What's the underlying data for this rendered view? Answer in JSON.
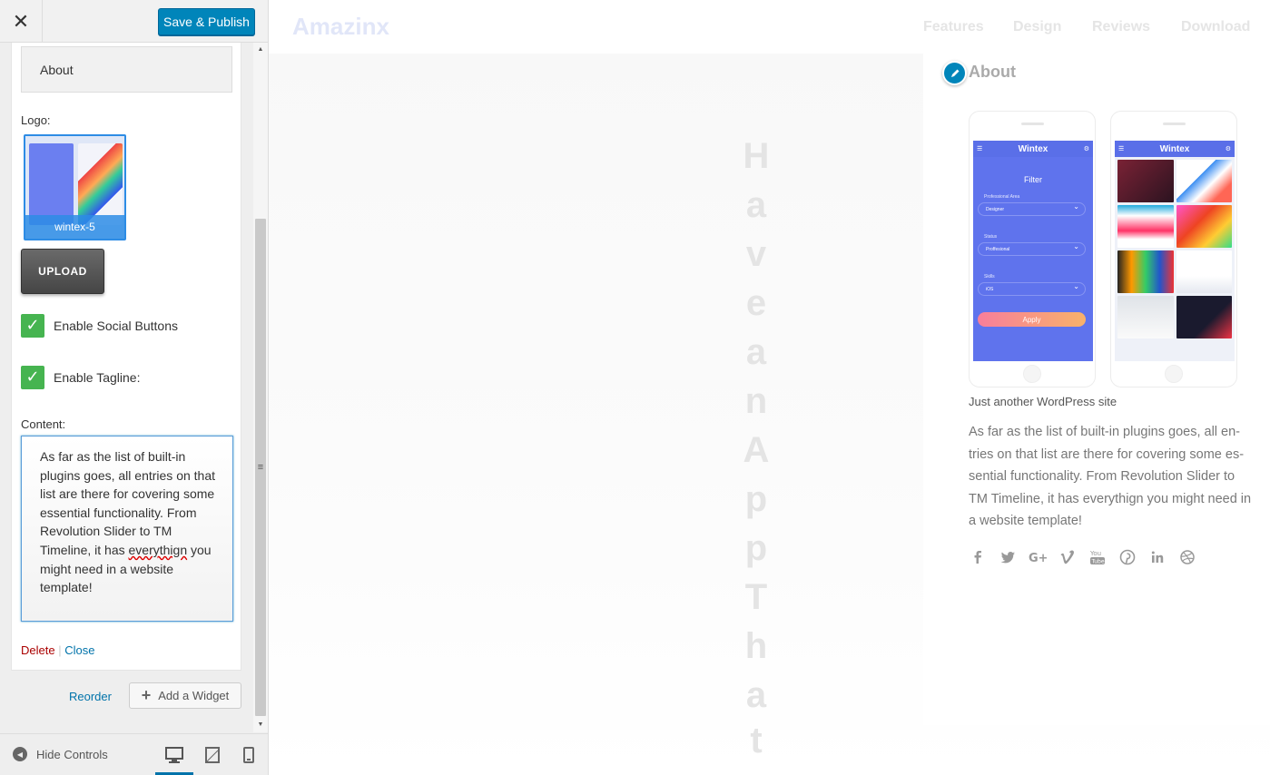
{
  "sidebar": {
    "close_glyph": "✕",
    "publish_label": "Save & Publish",
    "widget": {
      "title_value": "About",
      "logo_label": "Logo:",
      "logo_caption": "wintex-5",
      "upload_label": "UPLOAD",
      "social_checkbox": {
        "label": "Enable Social Buttons",
        "checked": true
      },
      "tagline_checkbox": {
        "label": "Enable Tagline:",
        "checked": true
      },
      "content_label": "Content:",
      "content_before": "As far as the list of built-in plugins goes, all entries on that list are there for covering some essential functionality. From Revolution Slider to TM Timeline, it has ",
      "content_misspelled": "everythign",
      "content_after": " you might need in a website template!",
      "delete_label": "Delete",
      "separator": "|",
      "close_label": "Close"
    },
    "reorder_label": "Reorder",
    "add_widget_label": "Add a Widget",
    "hide_controls_label": "Hide Controls",
    "devices": [
      "desktop-icon",
      "tablet-icon",
      "mobile-icon"
    ],
    "active_device": "desktop"
  },
  "preview": {
    "brand": "Amazinx",
    "nav": [
      "Features",
      "Design",
      "Reviews",
      "Download"
    ],
    "hero_letters": [
      "H",
      "a",
      "v",
      "e",
      "a",
      "n",
      "A",
      "p",
      "p",
      "T",
      "h",
      "a",
      "t"
    ],
    "about": {
      "title": "About",
      "phone1": {
        "app_title": "Wintex",
        "filter_title": "Filter",
        "fields": [
          {
            "label": "Professional Area",
            "value": "Designer"
          },
          {
            "label": "Status",
            "value": "Proffesional"
          },
          {
            "label": "Skills",
            "value": "iOS"
          }
        ],
        "apply_label": "Apply"
      },
      "phone2": {
        "app_title": "Wintex"
      },
      "tagline": "Just another WordPress site",
      "text": "As far as the list of built-in plugins goes, all en-tries on that list are there for covering some es-sential functionality. From Revolution Slider to TM Timeline, it has everythign you might need in a website template!",
      "social": [
        "facebook-icon",
        "twitter-icon",
        "google-plus-icon",
        "vimeo-icon",
        "youtube-icon",
        "pinterest-icon",
        "linkedin-icon",
        "dribbble-icon"
      ]
    }
  },
  "colors": {
    "publish": "#0085ba",
    "checkbox": "#46b450",
    "delete": "#a00",
    "link": "#0073aa",
    "app_primary": "#5f73ed"
  }
}
